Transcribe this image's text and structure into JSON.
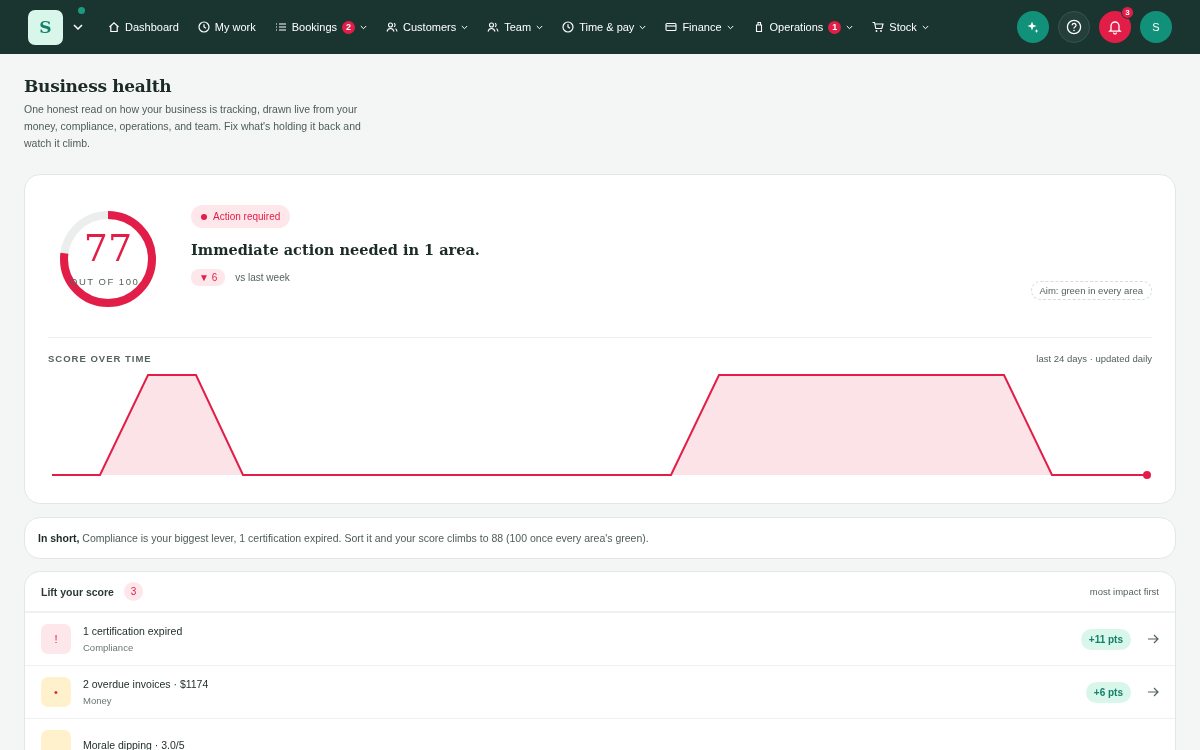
{
  "nav": {
    "logo": "S",
    "items": [
      {
        "label": "Dashboard",
        "menu": false
      },
      {
        "label": "My work",
        "menu": false
      },
      {
        "label": "Bookings",
        "badge": "2",
        "menu": true
      },
      {
        "label": "Customers",
        "menu": true
      },
      {
        "label": "Team",
        "menu": true
      },
      {
        "label": "Time & pay",
        "menu": true
      },
      {
        "label": "Finance",
        "menu": true
      },
      {
        "label": "Operations",
        "badge": "1",
        "menu": true
      },
      {
        "label": "Stock",
        "menu": true
      }
    ],
    "notifications": "3",
    "avatar": "S"
  },
  "page": {
    "title": "Business health",
    "description": "One honest read on how your business is tracking, drawn live from your money, compliance, operations, and team. Fix what's holding it back and watch it climb."
  },
  "score": {
    "value": "77",
    "caption": "OUT OF 100",
    "level": 0.77,
    "status": "Action required",
    "headline": "Immediate action needed in 1 area.",
    "delta": "▼ 6",
    "delta_label": "vs last week",
    "aim": "Aim: green in every area"
  },
  "trend": {
    "title": "SCORE OVER TIME",
    "note": "last 24 days · updated daily"
  },
  "summary": {
    "text": "**In short,** Compliance is your biggest lever, 1 certification expired. Sort it and your score climbs to 88 (100 once every area's green)."
  },
  "actions": {
    "title": "Lift your score",
    "count": "3",
    "sort": "most impact first",
    "items": [
      {
        "kind": "critical",
        "icon": "!",
        "title": "1 certification expired",
        "area": "Compliance",
        "points": "+11 pts"
      },
      {
        "kind": "warning",
        "icon": "•",
        "title": "2 overdue invoices · $1174",
        "area": "Money",
        "points": "+6 pts"
      },
      {
        "kind": "warning",
        "title": "Morale dipping · 3.0/5"
      }
    ]
  }
}
